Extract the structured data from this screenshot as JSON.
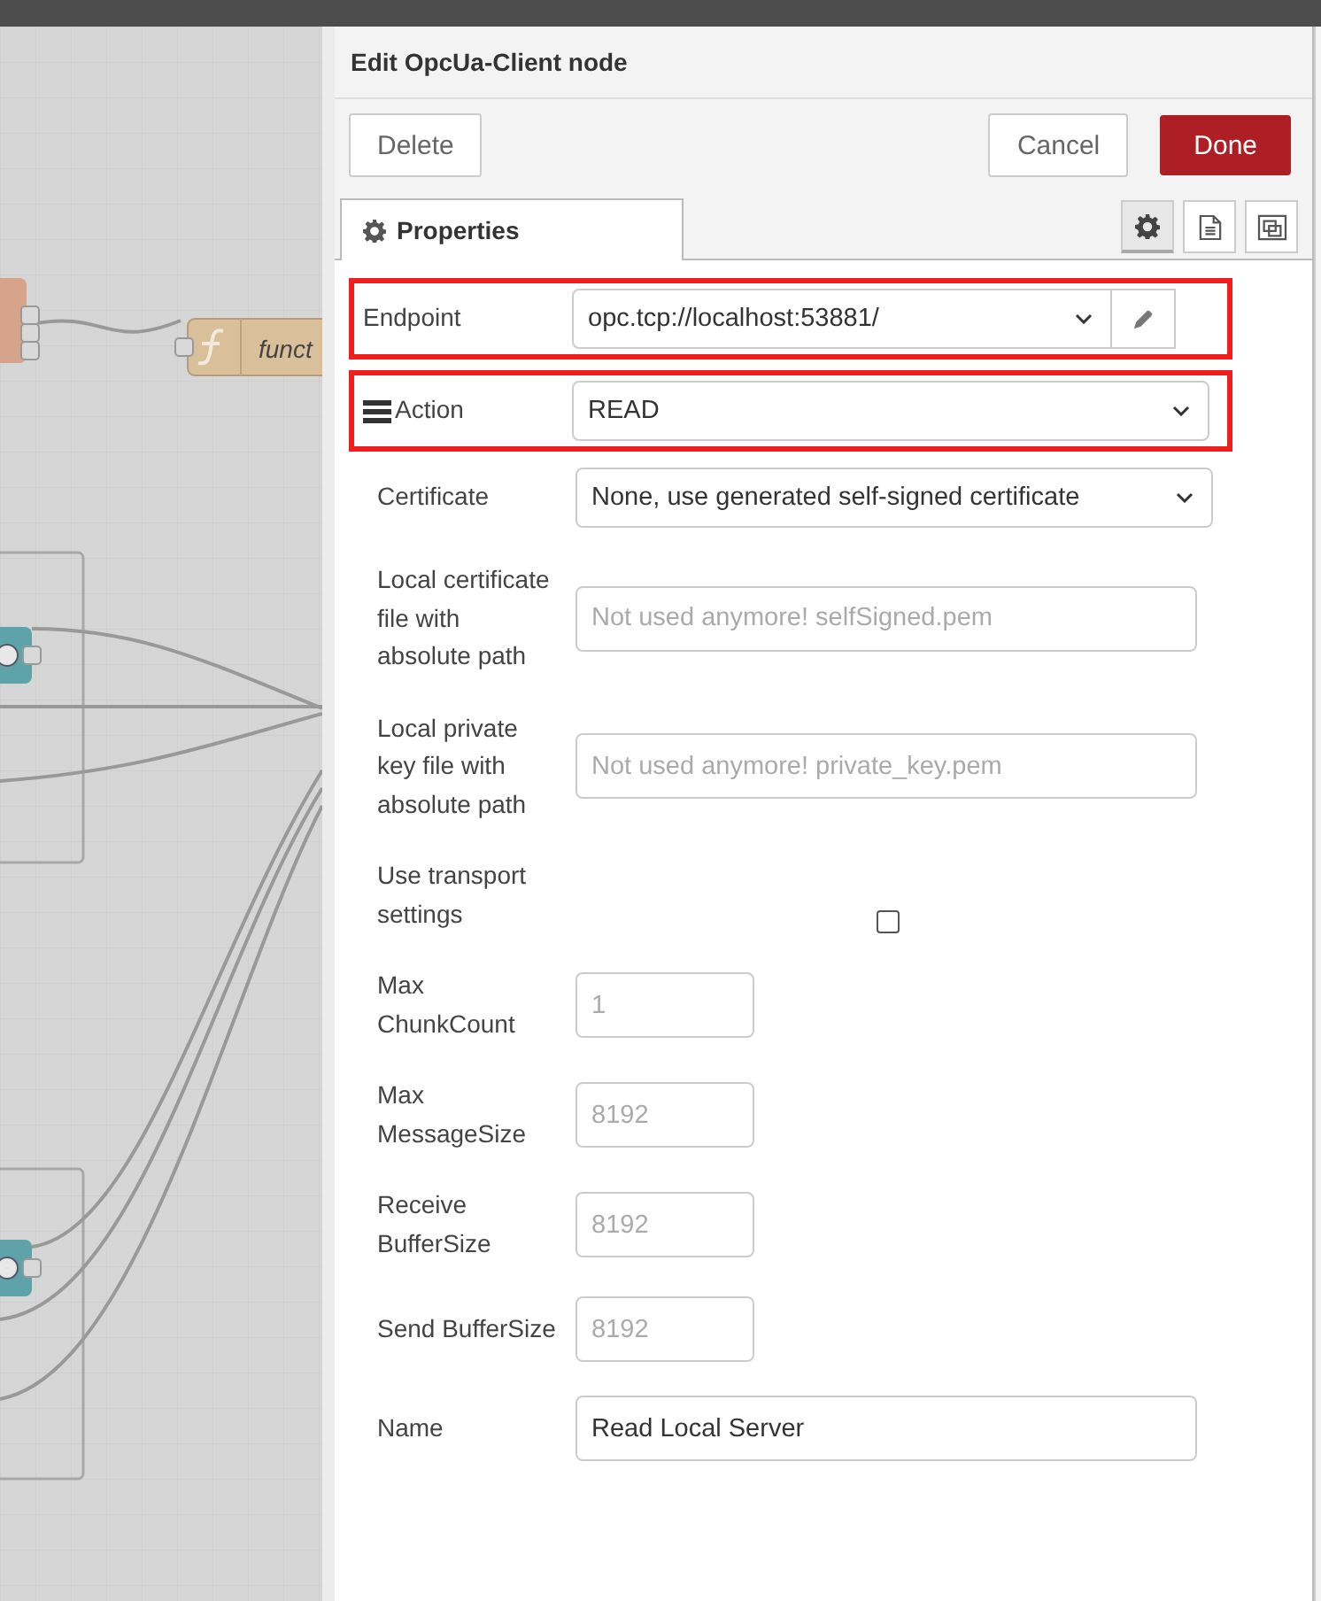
{
  "canvas": {
    "node_label": "funct"
  },
  "dialog": {
    "title": "Edit OpcUa-Client node"
  },
  "buttons": [
    {
      "label": "Delete",
      "kind": "plain"
    },
    {
      "label": "Cancel",
      "kind": "plain"
    },
    {
      "label": "Done",
      "kind": "primary"
    }
  ],
  "tabs": [
    {
      "label": "Properties",
      "selected": true
    }
  ],
  "tab_tools": [
    {
      "kind": "gear",
      "selected": true
    },
    {
      "kind": "document",
      "selected": false
    },
    {
      "kind": "frame",
      "selected": false
    }
  ],
  "fields": [
    {
      "label": "Endpoint",
      "kind": "select-edit",
      "value": "opc.tcp://localhost:53881/",
      "highlighted": true
    },
    {
      "label": "Action",
      "kind": "select",
      "value": "READ",
      "highlighted": true,
      "label_icon": true
    },
    {
      "label": "Certificate",
      "kind": "select",
      "value": "None, use generated self-signed certificate",
      "highlighted": false
    },
    {
      "label": "Local certificate file with absolute path",
      "kind": "input",
      "placeholder": "Not used anymore! selfSigned.pem",
      "highlighted": false
    },
    {
      "label": "Local private key file with absolute path",
      "kind": "input",
      "placeholder": "Not used anymore! private_key.pem",
      "highlighted": false
    },
    {
      "label": "Use transport settings",
      "kind": "checkbox",
      "checked": false,
      "highlighted": false
    },
    {
      "label": "Max ChunkCount",
      "kind": "short-input",
      "placeholder": "1",
      "highlighted": false
    },
    {
      "label": "Max MessageSize",
      "kind": "short-input",
      "placeholder": "8192",
      "highlighted": false
    },
    {
      "label": "Receive BufferSize",
      "kind": "short-input",
      "placeholder": "8192",
      "highlighted": false
    },
    {
      "label": "Send BufferSize",
      "kind": "short-input",
      "placeholder": "8192",
      "highlighted": false
    },
    {
      "label": "Name",
      "kind": "input",
      "value": "Read Local Server",
      "highlighted": false
    }
  ]
}
